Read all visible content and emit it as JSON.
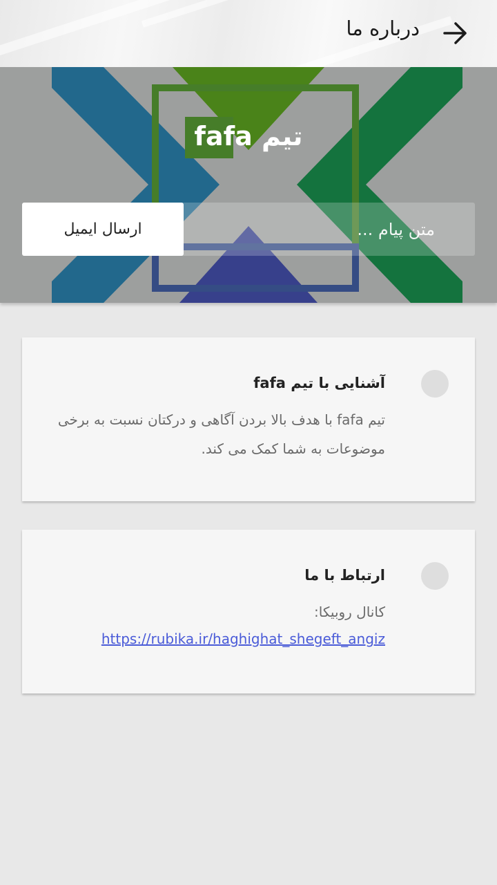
{
  "header": {
    "title": "درباره ما",
    "back_icon": "arrow-right-icon"
  },
  "hero": {
    "title": "تیم fafa",
    "message_placeholder": "متن پیام ...",
    "send_label": "ارسال ایمیل"
  },
  "cards": [
    {
      "title": "آشنایی با تیم fafa",
      "text": "تیم fafa با هدف بالا بردن آگاهی و درکتان نسبت به برخی موضوعات به شما کمک می کند."
    },
    {
      "title": "ارتباط با ما",
      "text": "کانال روبیکا:",
      "link": "https://rubika.ir/haghighat_shegeft_angiz"
    }
  ],
  "colors": {
    "blue": "#2e7ea3",
    "green": "#1e8a4e",
    "lime": "#5ea223",
    "indigo": "#4251a6",
    "link": "#4a5bd8"
  }
}
